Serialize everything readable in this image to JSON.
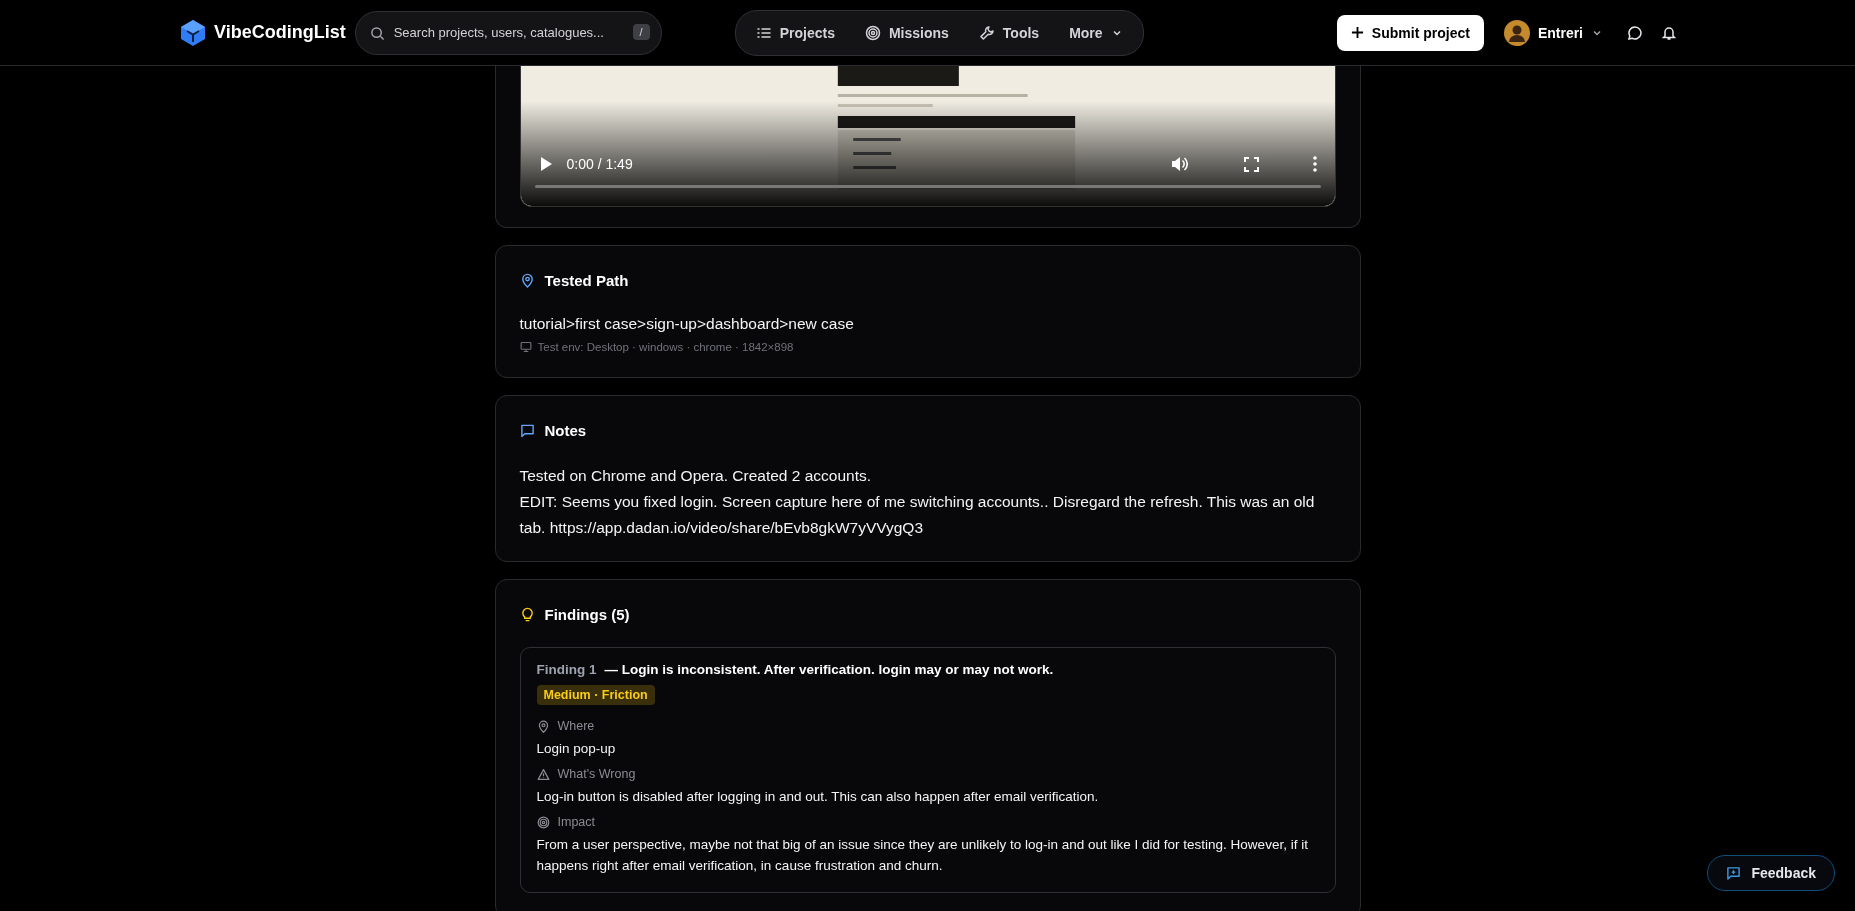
{
  "header": {
    "logo": "VibeCodingList",
    "search": {
      "placeholder": "Search projects, users, catalogues...",
      "shortcut": "/"
    },
    "nav": [
      {
        "label": "Projects",
        "kind": "list"
      },
      {
        "label": "Missions",
        "kind": "target"
      },
      {
        "label": "Tools",
        "kind": "wrench"
      },
      {
        "label": "More",
        "kind": "dropdown"
      }
    ],
    "submit": "Submit project",
    "user": "Entreri"
  },
  "video": {
    "time": "0:00 / 1:49"
  },
  "tested_path": {
    "title": "Tested Path",
    "path": "tutorial>first case>sign-up>dashboard>new case",
    "env": "Test env: Desktop · windows · chrome · 1842×898"
  },
  "notes": {
    "title": "Notes",
    "paragraphs": [
      "Tested on Chrome and Opera. Created 2 accounts.",
      "EDIT: Seems you fixed login. Screen capture here of me switching accounts.. Disregard the refresh. This was an old tab.  https://app.dadan.io/video/share/bEvb8gkW7yVVygQ3"
    ]
  },
  "findings": {
    "title": "Findings (5)",
    "items": [
      {
        "number": "Finding 1",
        "title": "— Login is inconsistent. After verification. login may or may not work.",
        "badge": "Medium · Friction",
        "fields": [
          {
            "kind": "where",
            "label": "Where",
            "value": "Login pop-up"
          },
          {
            "kind": "problem",
            "label": "What's Wrong",
            "value": "Log-in button is disabled after logging in and out. This can also happen after email verification."
          },
          {
            "kind": "impact",
            "label": "Impact",
            "value": "From a user perspective, maybe not that big of an issue since they are unlikely to log-in and out like I did for testing. However, if it happens right after email verification, in cause frustration and churn."
          }
        ]
      }
    ]
  },
  "feedback": "Feedback"
}
